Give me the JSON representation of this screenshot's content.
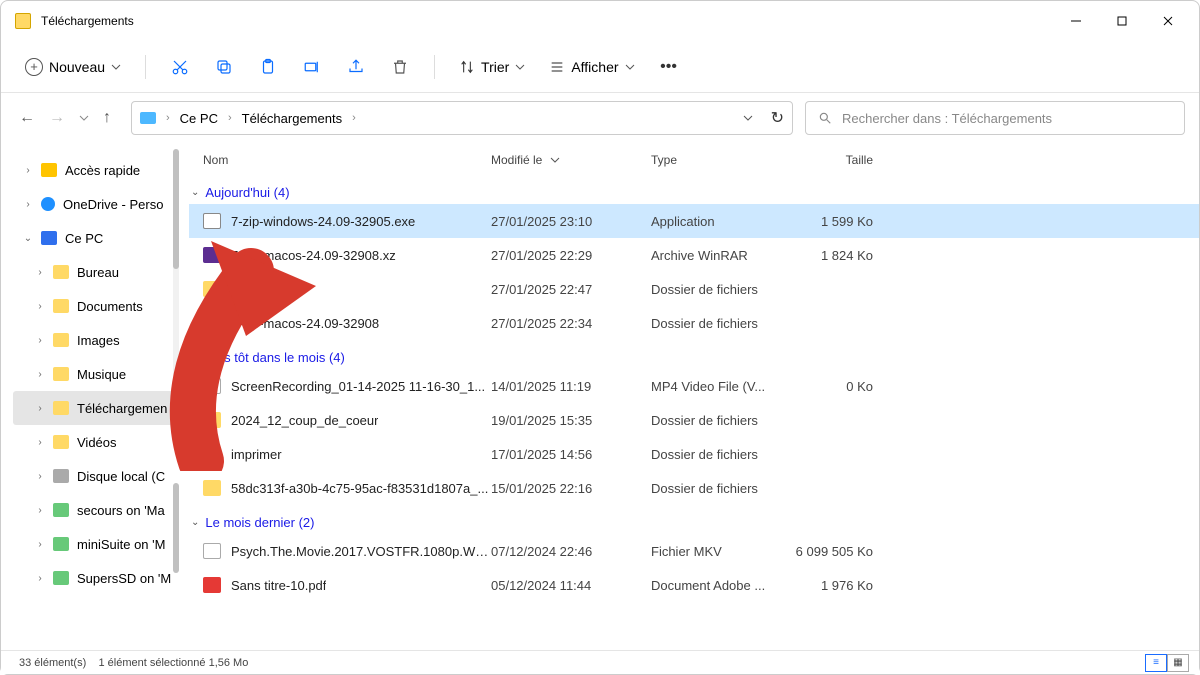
{
  "window": {
    "title": "Téléchargements"
  },
  "toolbar": {
    "new_label": "Nouveau",
    "sort_label": "Trier",
    "view_label": "Afficher"
  },
  "breadcrumb": {
    "root": "Ce PC",
    "current": "Téléchargements"
  },
  "search": {
    "placeholder": "Rechercher dans : Téléchargements"
  },
  "sidebar": [
    {
      "caret": ">",
      "icon": "ic-star",
      "label": "Accès rapide"
    },
    {
      "caret": ">",
      "icon": "ic-cloud",
      "label": "OneDrive - Perso"
    },
    {
      "caret": "v",
      "icon": "ic-monitor",
      "label": "Ce PC"
    },
    {
      "caret": ">",
      "icon": "ic-folder",
      "label": "Bureau",
      "indent": true
    },
    {
      "caret": ">",
      "icon": "ic-folder",
      "label": "Documents",
      "indent": true
    },
    {
      "caret": ">",
      "icon": "ic-folder",
      "label": "Images",
      "indent": true
    },
    {
      "caret": ">",
      "icon": "ic-folder",
      "label": "Musique",
      "indent": true
    },
    {
      "caret": ">",
      "icon": "ic-folder",
      "label": "Téléchargemen",
      "indent": true,
      "selected": true
    },
    {
      "caret": ">",
      "icon": "ic-folder",
      "label": "Vidéos",
      "indent": true
    },
    {
      "caret": ">",
      "icon": "ic-disk",
      "label": "Disque local (C",
      "indent": true
    },
    {
      "caret": ">",
      "icon": "ic-net",
      "label": "secours on 'Ma",
      "indent": true
    },
    {
      "caret": ">",
      "icon": "ic-net",
      "label": "miniSuite on 'M",
      "indent": true
    },
    {
      "caret": ">",
      "icon": "ic-net",
      "label": "SupersSD on 'M",
      "indent": true
    }
  ],
  "columns": {
    "name": "Nom",
    "modified": "Modifié le",
    "type": "Type",
    "size": "Taille"
  },
  "groups": [
    {
      "label": "Aujourd'hui (4)",
      "rows": [
        {
          "icon": "fi-exe",
          "name": "7-zip-windows-24.09-32905.exe",
          "mod": "27/01/2025 23:10",
          "type": "Application",
          "size": "1 599 Ko",
          "selected": true
        },
        {
          "icon": "fi-xz",
          "name": "7-zip-macos-24.09-32908.xz",
          "mod": "27/01/2025 22:29",
          "type": "Archive WinRAR",
          "size": "1 824 Ko",
          "obscured": true
        },
        {
          "icon": "fi-folder",
          "name": "",
          "mod": "27/01/2025 22:47",
          "type": "Dossier de fichiers",
          "size": "",
          "obscured": true
        },
        {
          "icon": "fi-folder",
          "name": "7-zip-macos-24.09-32908",
          "mod": "27/01/2025 22:34",
          "type": "Dossier de fichiers",
          "size": "",
          "obscured": true
        }
      ]
    },
    {
      "label": "Plus tôt dans le mois (4)",
      "obscured": true,
      "rows": [
        {
          "icon": "fi-mp4",
          "name": "ScreenRecording_01-14-2025 11-16-30_1...",
          "mod": "14/01/2025 11:19",
          "type": "MP4 Video File (V...",
          "size": "0 Ko",
          "obscured": true
        },
        {
          "icon": "fi-folder",
          "name": "2024_12_coup_de_coeur",
          "mod": "19/01/2025 15:35",
          "type": "Dossier de fichiers",
          "size": ""
        },
        {
          "icon": "fi-folder",
          "name": "imprimer",
          "mod": "17/01/2025 14:56",
          "type": "Dossier de fichiers",
          "size": ""
        },
        {
          "icon": "fi-folder",
          "name": "58dc313f-a30b-4c75-95ac-f83531d1807a_...",
          "mod": "15/01/2025 22:16",
          "type": "Dossier de fichiers",
          "size": ""
        }
      ]
    },
    {
      "label": "Le mois dernier (2)",
      "rows": [
        {
          "icon": "fi-mp4",
          "name": "Psych.The.Movie.2017.VOSTFR.1080p.WE...",
          "mod": "07/12/2024 22:46",
          "type": "Fichier MKV",
          "size": "6 099 505 Ko"
        },
        {
          "icon": "fi-pdf",
          "name": "Sans titre-10.pdf",
          "mod": "05/12/2024 11:44",
          "type": "Document Adobe ...",
          "size": "1 976 Ko"
        }
      ]
    }
  ],
  "status": {
    "count": "33 élément(s)",
    "selection": "1 élément sélectionné  1,56 Mo"
  }
}
